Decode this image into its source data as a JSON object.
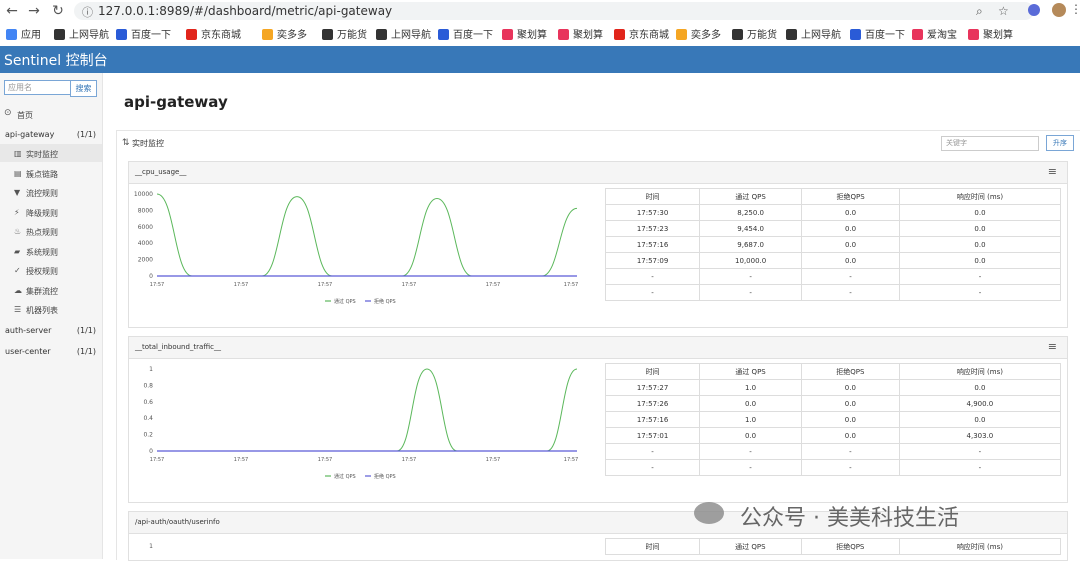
{
  "browser": {
    "url": "127.0.0.1:8989/#/dashboard/metric/api-gateway",
    "bookmarks": [
      {
        "label": "应用",
        "color": "#4285f4",
        "icon": "apps-icon"
      },
      {
        "label": "上网导航",
        "color": "#333",
        "icon": "globe-icon"
      },
      {
        "label": "百度一下",
        "color": "#2a5bd7",
        "icon": "baidu-icon"
      },
      {
        "label": "京东商城",
        "color": "#e1251b",
        "icon": "jd-icon"
      },
      {
        "label": "奕多多",
        "color": "#f5a623",
        "icon": "star-icon"
      },
      {
        "label": "万能货",
        "color": "#333",
        "icon": "globe-icon"
      },
      {
        "label": "上网导航",
        "color": "#333",
        "icon": "globe-icon"
      },
      {
        "label": "百度一下",
        "color": "#2a5bd7",
        "icon": "baidu-icon"
      },
      {
        "label": "聚划算",
        "color": "#e8345c",
        "icon": "juhuasuan-icon"
      },
      {
        "label": "聚划算",
        "color": "#e8345c",
        "icon": "juhuasuan-icon"
      },
      {
        "label": "京东商城",
        "color": "#e1251b",
        "icon": "jd-icon"
      },
      {
        "label": "奕多多",
        "color": "#f5a623",
        "icon": "star-icon"
      },
      {
        "label": "万能货",
        "color": "#333",
        "icon": "globe-icon"
      },
      {
        "label": "上网导航",
        "color": "#333",
        "icon": "globe-icon"
      },
      {
        "label": "百度一下",
        "color": "#2a5bd7",
        "icon": "baidu-icon"
      },
      {
        "label": "爱淘宝",
        "color": "#e8345c",
        "icon": "taobao-icon"
      },
      {
        "label": "聚划算",
        "color": "#e8345c",
        "icon": "juhuasuan-icon"
      }
    ]
  },
  "app": {
    "title": "Sentinel 控制台",
    "header_color": "#3878b8"
  },
  "sidebar": {
    "search_placeholder": "应用名",
    "search_button": "搜索",
    "home": "首页",
    "apps": [
      {
        "name": "api-gateway",
        "count": "(1/1)"
      },
      {
        "name": "auth-server",
        "count": "(1/1)"
      },
      {
        "name": "user-center",
        "count": "(1/1)"
      }
    ],
    "menu": [
      {
        "label": "实时监控",
        "icon": "bar-chart-icon",
        "active": true
      },
      {
        "label": "簇点链路",
        "icon": "table-icon"
      },
      {
        "label": "流控规则",
        "icon": "filter-icon"
      },
      {
        "label": "降级规则",
        "icon": "flash-icon"
      },
      {
        "label": "热点规则",
        "icon": "fire-icon"
      },
      {
        "label": "系统规则",
        "icon": "lock-icon"
      },
      {
        "label": "授权规则",
        "icon": "check-circle-icon"
      },
      {
        "label": "集群流控",
        "icon": "cloud-icon"
      },
      {
        "label": "机器列表",
        "icon": "list-icon"
      }
    ]
  },
  "main": {
    "page_title": "api-gateway",
    "section_label": "实时监控",
    "keyword_placeholder": "关键字",
    "sort_button": "升序",
    "table_headers": [
      "时间",
      "通过 QPS",
      "拒绝QPS",
      "响应时间 (ms)"
    ],
    "legend": {
      "pass": "通过 QPS",
      "block": "拒绝 QPS"
    },
    "colors": {
      "pass": "#5cb85c",
      "block": "#5b5bd6"
    },
    "panels": [
      {
        "title": "__cpu_usage__",
        "rows": [
          [
            "17:57:30",
            "8,250.0",
            "0.0",
            "0.0"
          ],
          [
            "17:57:23",
            "9,454.0",
            "0.0",
            "0.0"
          ],
          [
            "17:57:16",
            "9,687.0",
            "0.0",
            "0.0"
          ],
          [
            "17:57:09",
            "10,000.0",
            "0.0",
            "0.0"
          ],
          [
            "-",
            "-",
            "-",
            "-"
          ],
          [
            "-",
            "-",
            "-",
            "-"
          ]
        ]
      },
      {
        "title": "__total_inbound_traffic__",
        "rows": [
          [
            "17:57:27",
            "1.0",
            "0.0",
            "0.0"
          ],
          [
            "17:57:26",
            "0.0",
            "0.0",
            "4,900.0"
          ],
          [
            "17:57:16",
            "1.0",
            "0.0",
            "0.0"
          ],
          [
            "17:57:01",
            "0.0",
            "0.0",
            "4,303.0"
          ],
          [
            "-",
            "-",
            "-",
            "-"
          ],
          [
            "-",
            "-",
            "-",
            "-"
          ]
        ]
      },
      {
        "title": "/api-auth/oauth/userinfo",
        "rows": []
      }
    ]
  },
  "chart_data": [
    {
      "type": "line",
      "x": [
        "17:57",
        "17:57",
        "17:57",
        "17:57",
        "17:57",
        "17:57"
      ],
      "yticks": [
        0,
        2000,
        4000,
        6000,
        8000,
        10000
      ],
      "ylim": [
        0,
        10000
      ],
      "series": [
        {
          "name": "通过 QPS",
          "values": [
            10000,
            0,
            0,
            0,
            9687,
            0,
            0,
            0,
            9454,
            0,
            0,
            0,
            8250
          ]
        },
        {
          "name": "拒绝 QPS",
          "values": [
            0,
            0,
            0,
            0,
            0,
            0,
            0,
            0,
            0,
            0,
            0,
            0,
            0
          ]
        }
      ]
    },
    {
      "type": "line",
      "x": [
        "17:57",
        "17:57",
        "17:57",
        "17:57",
        "17:57",
        "17:57"
      ],
      "yticks": [
        0,
        0.2,
        0.4,
        0.6,
        0.8,
        1
      ],
      "ylim": [
        0,
        1
      ],
      "series": [
        {
          "name": "通过 QPS",
          "values": [
            0,
            0,
            0,
            0,
            0,
            0,
            0,
            0,
            0,
            1,
            0,
            0,
            0,
            0,
            1
          ]
        },
        {
          "name": "拒绝 QPS",
          "values": [
            0,
            0,
            0,
            0,
            0,
            0,
            0,
            0,
            0,
            0,
            0,
            0,
            0,
            0,
            0
          ]
        }
      ]
    },
    {
      "type": "line",
      "yticks": [
        1
      ],
      "series": []
    }
  ],
  "watermark": "公众号 · 美美科技生活"
}
